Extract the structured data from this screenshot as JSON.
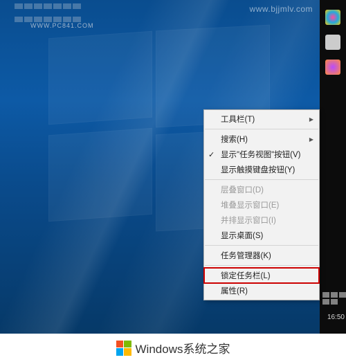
{
  "source_url": "WWW.PC841.COM",
  "watermark": "www.bjjmlv.com",
  "clock": "16:50",
  "context_menu": {
    "toolbars": "工具栏(T)",
    "search": "搜索(H)",
    "show_taskview": "显示\"任务视图\"按钮(V)",
    "show_touchkb": "显示触摸键盘按钮(Y)",
    "cascade": "层叠窗口(D)",
    "stacked": "堆叠显示窗口(E)",
    "sidebyside": "并排显示窗口(I)",
    "show_desktop": "显示桌面(S)",
    "task_manager": "任务管理器(K)",
    "lock_taskbar": "锁定任务栏(L)",
    "properties": "属性(R)"
  },
  "footer": {
    "brand": "Windows系统之家"
  }
}
